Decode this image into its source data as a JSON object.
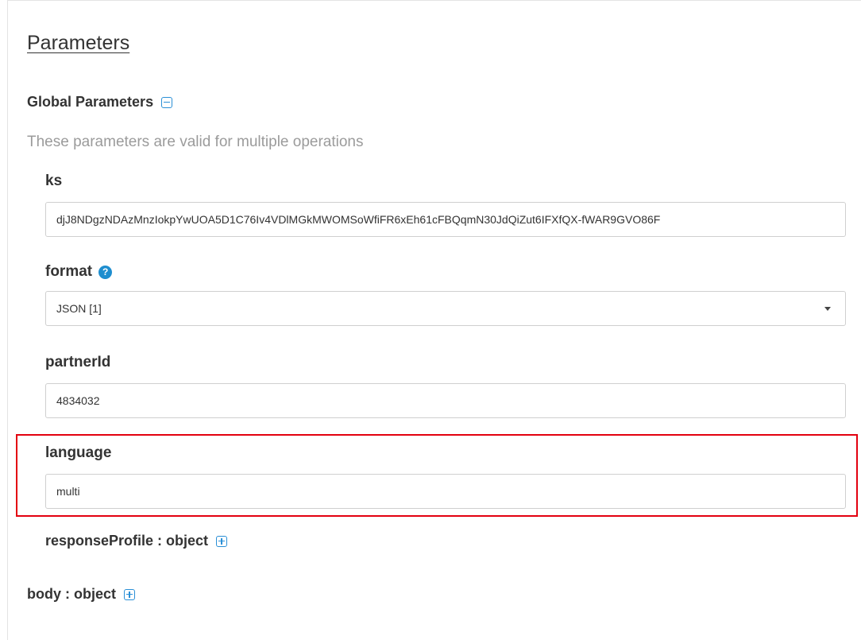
{
  "panel": {
    "title": "Parameters",
    "global_section": {
      "heading": "Global Parameters",
      "toggle_icon": "collapse-icon",
      "description": "These parameters are valid for multiple operations"
    },
    "fields": {
      "ks": {
        "label": "ks",
        "value": "djJ8NDgzNDAzMnzIokpYwUOA5D1C76Iv4VDlMGkMWOMSoWfiFR6xEh61cFBQqmN30JdQiZut6IFXfQX-fWAR9GVO86F"
      },
      "format": {
        "label": "format",
        "help_icon": "help-icon",
        "help_glyph": "?",
        "selected": "JSON [1]"
      },
      "partnerId": {
        "label": "partnerId",
        "value": "4834032"
      },
      "language": {
        "label": "language",
        "value": "multi"
      }
    },
    "response_profile": {
      "label": "responseProfile : object",
      "toggle_icon": "expand-icon"
    },
    "body": {
      "label": "body : object",
      "toggle_icon": "expand-icon"
    }
  },
  "colors": {
    "accent": "#2a8fd6",
    "highlight": "#e3000f",
    "muted_text": "#9b9b9b"
  }
}
